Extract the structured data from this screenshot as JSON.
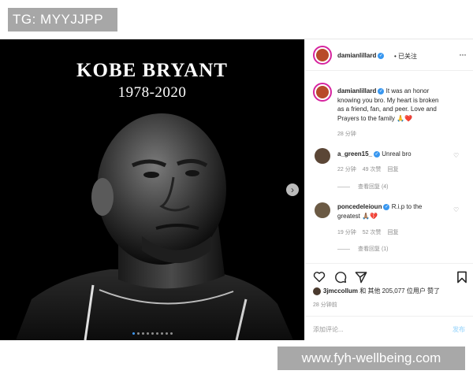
{
  "tag": "TG: MYYJJPP",
  "watermark": "www.fyh-wellbeing.com",
  "post": {
    "image_title": "KOBE BRYANT",
    "image_years": "1978-2020",
    "author": "damianlillard",
    "follow_status": "• 已关注",
    "more_icon": "ellipsis-icon",
    "caption_user": "damianlillard",
    "caption_lines": [
      "It was an honor",
      "knowing you bro. My heart is broken",
      "as a friend, fan, and peer. Love and",
      "Prayers to the family 🙏❤️"
    ],
    "caption_time": "28 分钟",
    "colors": {
      "verified": "#3897f0",
      "story_ring": "#d6249f",
      "link_blue": "#b2dffc"
    }
  },
  "comments": [
    {
      "user": "a_green15_",
      "text": "Unreal bro",
      "time": "22 分钟",
      "likes": "49 次赞",
      "reply": "回复",
      "view_replies": "查看回复 (4)"
    },
    {
      "user": "poncedeleioun",
      "text_lines": [
        "R.i.p to the",
        "greatest 🙏🏽💔"
      ],
      "time": "19 分钟",
      "likes": "52 次赞",
      "reply": "回复",
      "view_replies": "查看回复 (1)"
    }
  ],
  "footer": {
    "likes_user": "3jmccollum",
    "likes_text": " 和 其他 205,077 位用户 赞了",
    "time": "28 分钟前",
    "add_comment_placeholder": "添加评论...",
    "post_label": "发布"
  },
  "carousel": {
    "count": 9,
    "active": 0
  }
}
